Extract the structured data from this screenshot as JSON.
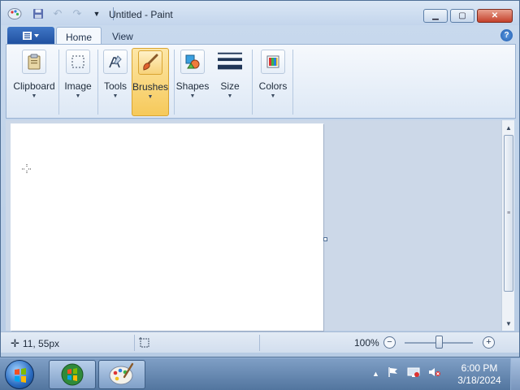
{
  "window": {
    "title": "Untitled - Paint",
    "qat_icons": [
      "save-icon",
      "undo-icon",
      "redo-icon",
      "customize-dropdown-icon"
    ],
    "controls": [
      "minimize",
      "maximize",
      "close"
    ]
  },
  "tabs": {
    "file_menu_label": "",
    "items": [
      {
        "label": "Home",
        "active": true
      },
      {
        "label": "View",
        "active": false
      }
    ],
    "help": "?"
  },
  "ribbon": {
    "groups": [
      {
        "label": "Clipboard",
        "icon": "clipboard-icon"
      },
      {
        "label": "Image",
        "icon": "select-icon"
      },
      {
        "label": "Tools",
        "icon": "tools-icon"
      },
      {
        "label": "Brushes",
        "icon": "brush-icon",
        "selected": true
      },
      {
        "label": "Shapes",
        "icon": "shapes-icon"
      },
      {
        "label": "Size",
        "icon": "size-icon"
      },
      {
        "label": "Colors",
        "icon": "colors-icon"
      }
    ]
  },
  "statusbar": {
    "cursor_position": "11, 55px",
    "zoom": "100%",
    "zoom_out": "−",
    "zoom_in": "+"
  },
  "taskbar": {
    "time": "6:00 PM",
    "date": "3/18/2024"
  },
  "colors": {
    "accent": "#1f4f9e",
    "selected_group": "#f6c95a",
    "canvas": "#ffffff"
  }
}
